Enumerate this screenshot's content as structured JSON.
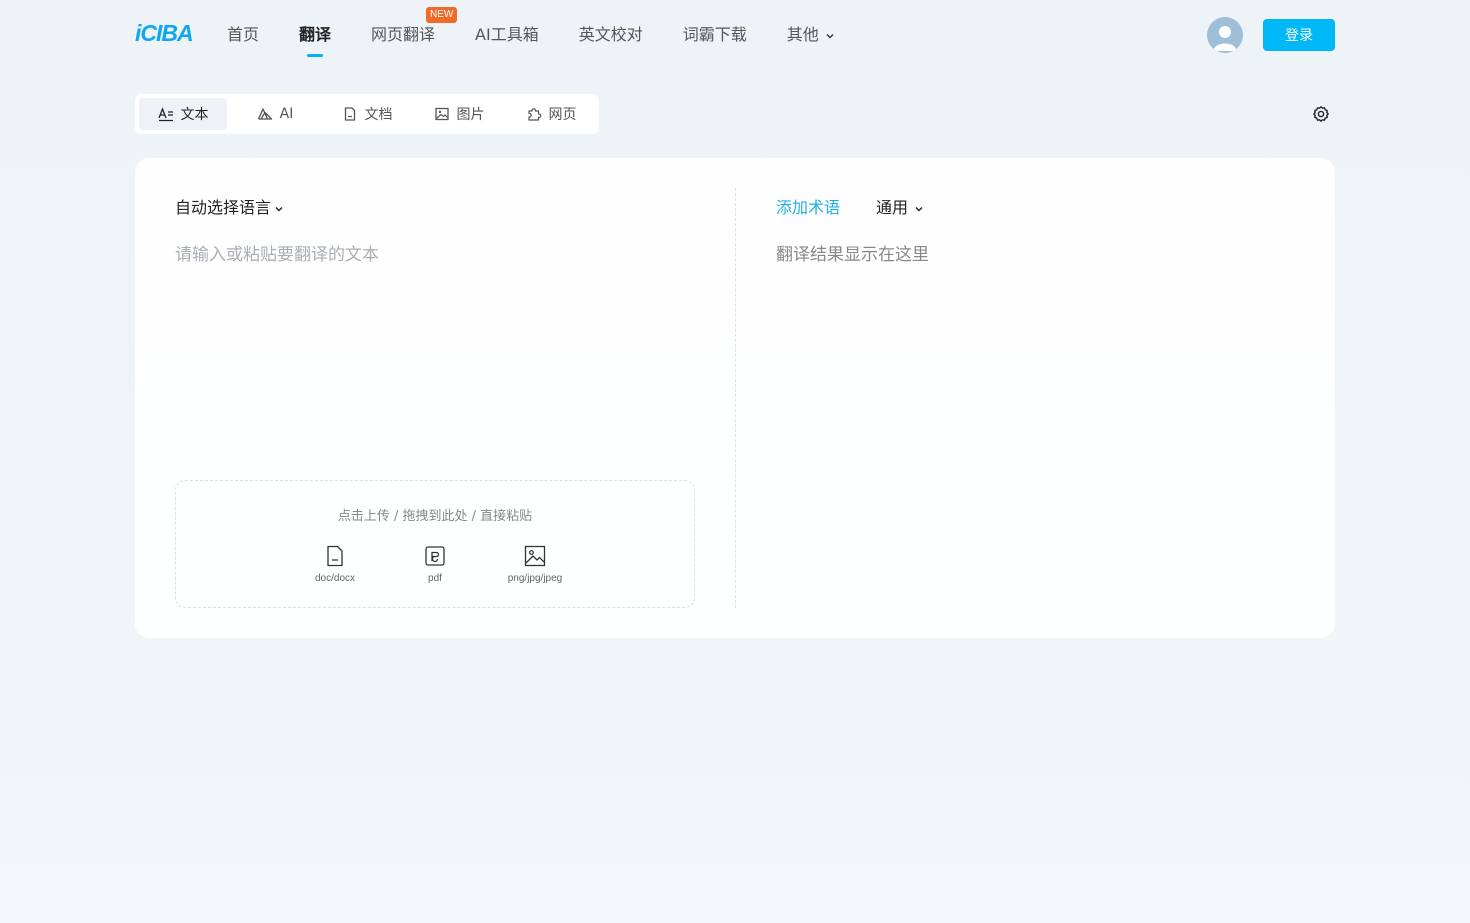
{
  "header": {
    "logo": "iCIBA",
    "nav": [
      {
        "label": "首页"
      },
      {
        "label": "翻译",
        "active": true
      },
      {
        "label": "网页翻译",
        "badge": "NEW"
      },
      {
        "label": "AI工具箱"
      },
      {
        "label": "英文校对"
      },
      {
        "label": "词霸下载"
      },
      {
        "label": "其他",
        "dropdown": true
      }
    ],
    "login_label": "登录",
    "avatar_icon": "user-avatar-icon"
  },
  "mode_tabs": [
    {
      "label": "文本",
      "icon": "text-icon",
      "active": true
    },
    {
      "label": "AI",
      "icon": "ai-icon"
    },
    {
      "label": "文档",
      "icon": "document-icon"
    },
    {
      "label": "图片",
      "icon": "image-icon"
    },
    {
      "label": "网页",
      "icon": "webpage-icon"
    }
  ],
  "source": {
    "language": "自动选择语言",
    "placeholder": "请输入或粘贴要翻译的文本",
    "upload_hint": "点击上传 / 拖拽到此处 / 直接粘贴",
    "file_types": [
      "doc/docx",
      "pdf",
      "png/jpg/jpeg"
    ]
  },
  "target": {
    "add_term": "添加术语",
    "domain": "通用",
    "placeholder": "翻译结果显示在这里"
  },
  "colors": {
    "accent": "#00b8f5",
    "badge": "#f06a2a",
    "link": "#1eaee8"
  }
}
